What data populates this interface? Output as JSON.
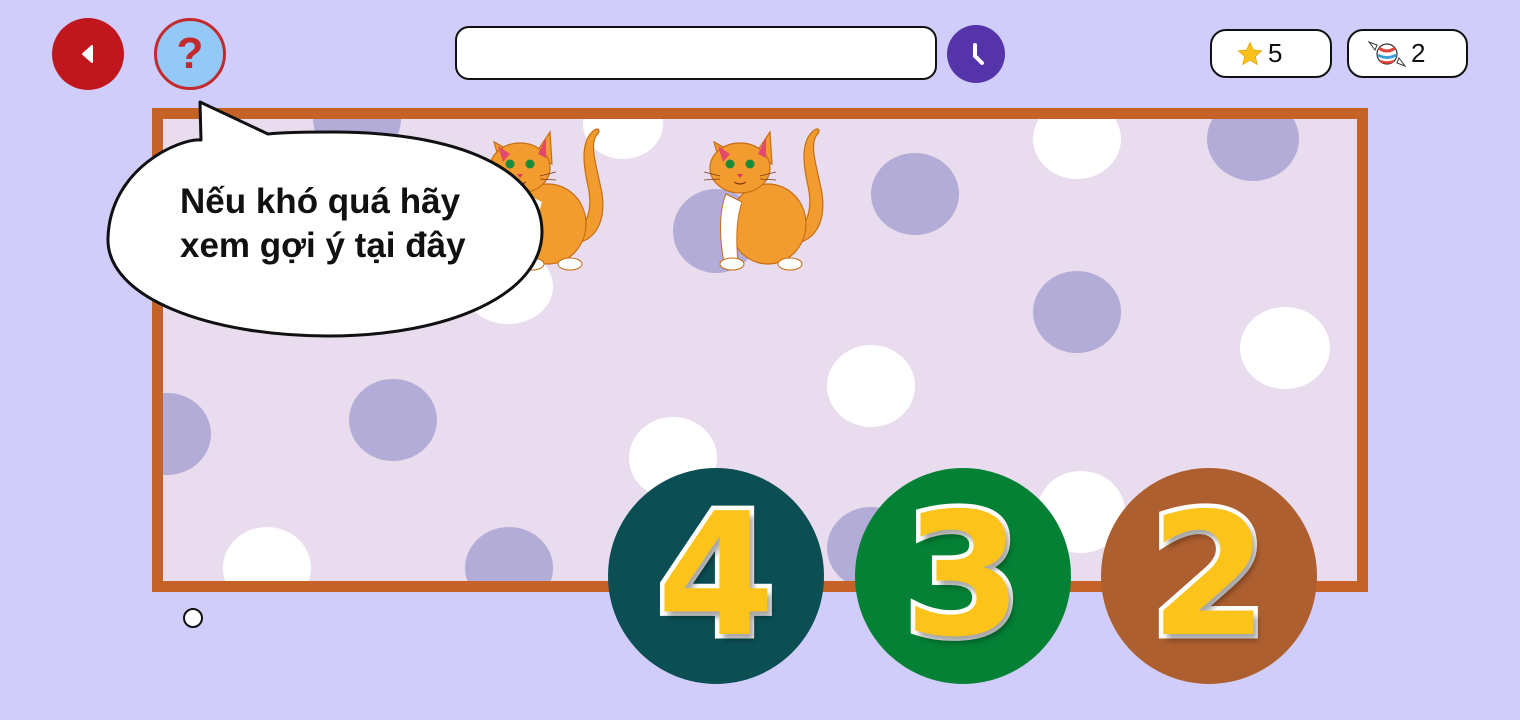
{
  "hud": {
    "stars": "5",
    "candies": "2",
    "progress_value": 0
  },
  "hint": {
    "line1": "Nếu khó quá hãy",
    "line2": "xem gợi ý tại đây"
  },
  "help_glyph": "?",
  "answers": [
    {
      "label": "4",
      "color": "#0b4f54"
    },
    {
      "label": "3",
      "color": "#048135"
    },
    {
      "label": "2",
      "color": "#ae5f2f"
    }
  ],
  "icons": {
    "back": "back-arrow-icon",
    "help": "question-mark-icon",
    "clock": "clock-icon",
    "star": "star-icon",
    "candy": "candy-icon"
  },
  "colors": {
    "background": "#d0cdfa",
    "board_border": "#c46228",
    "board_fill": "#e8dcee"
  }
}
